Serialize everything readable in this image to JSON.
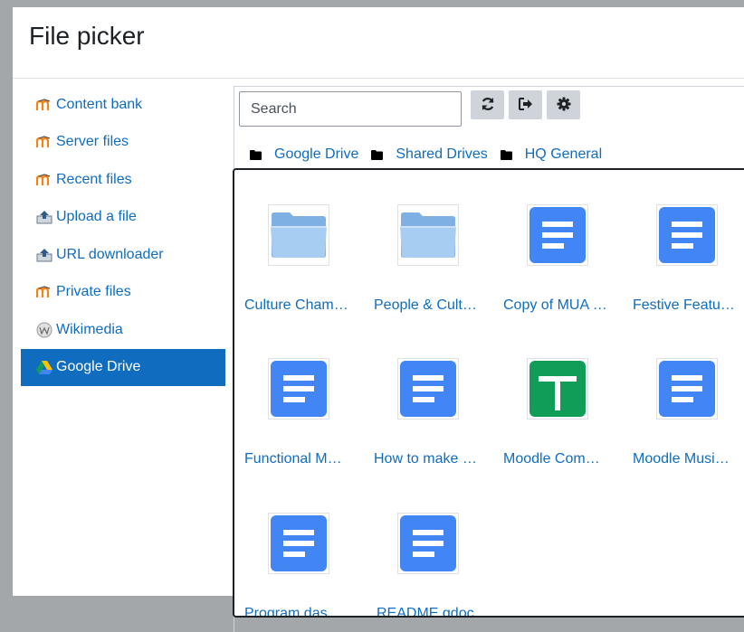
{
  "dialog": {
    "title": "File picker"
  },
  "sidebar": {
    "items": [
      {
        "label": "Content bank",
        "icon": "moodle-icon"
      },
      {
        "label": "Server files",
        "icon": "moodle-icon"
      },
      {
        "label": "Recent files",
        "icon": "moodle-icon"
      },
      {
        "label": "Upload a file",
        "icon": "upload-icon"
      },
      {
        "label": "URL downloader",
        "icon": "url-icon"
      },
      {
        "label": "Private files",
        "icon": "moodle-icon"
      },
      {
        "label": "Wikimedia",
        "icon": "wikimedia-icon"
      },
      {
        "label": "Google Drive",
        "icon": "google-drive-icon",
        "active": true
      }
    ]
  },
  "toolbar": {
    "search_placeholder": "Search",
    "refresh_icon": "refresh-icon",
    "logout_icon": "logout-icon",
    "settings_icon": "gear-icon"
  },
  "breadcrumb": [
    {
      "label": "Google Drive"
    },
    {
      "label": "Shared Drives"
    },
    {
      "label": "HQ General"
    }
  ],
  "files": [
    {
      "name": "Culture Champions",
      "display": "Culture Cham…",
      "type": "folder"
    },
    {
      "name": "People & Culture",
      "display": "People & Cult…",
      "type": "folder"
    },
    {
      "name": "Copy of MUA",
      "display": "Copy of MUA …",
      "type": "gdoc"
    },
    {
      "name": "Festive Features",
      "display": "Festive Featu…",
      "type": "gdoc"
    },
    {
      "name": "Functional M",
      "display": "Functional M…",
      "type": "gdoc"
    },
    {
      "name": "How to make",
      "display": "How to make …",
      "type": "gdoc"
    },
    {
      "name": "Moodle Com",
      "display": "Moodle Com…",
      "type": "gsheet"
    },
    {
      "name": "Moodle Musi",
      "display": "Moodle Musi…",
      "type": "gdoc"
    },
    {
      "name": "Program das",
      "display": "Program das…",
      "type": "gdoc"
    },
    {
      "name": "README.gdoc",
      "display": "README.gdoc",
      "type": "gdoc"
    }
  ],
  "colors": {
    "accent": "#0f6cbf",
    "doc_blue": "#4285f4",
    "sheet_green": "#0f9d58",
    "folder_blue": "#8ab9e8"
  }
}
